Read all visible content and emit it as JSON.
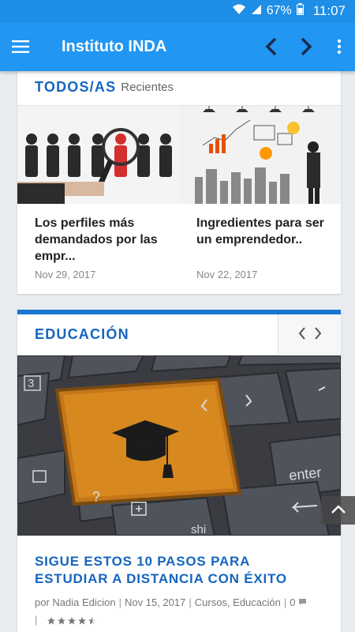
{
  "status_bar": {
    "battery": "67%",
    "time": "11:07"
  },
  "app_bar": {
    "title": "Instituto INDA"
  },
  "recent_section": {
    "title": "TODOS/AS",
    "subtitle": "Recientes",
    "posts": [
      {
        "title": "Los perfiles más demandados por las empr...",
        "date": "Nov 29, 2017"
      },
      {
        "title": "Ingredientes para ser un emprendedor..",
        "date": "Nov 22, 2017"
      }
    ]
  },
  "education_section": {
    "title": "EDUCACIÓN",
    "article": {
      "title": "SIGUE ESTOS 10 PASOS PARA ESTUDIAR A DISTANCIA CON ÉXITO",
      "author": "por Nadia Edicion",
      "date": "Nov 15, 2017",
      "categories": "Cursos, Educación",
      "comments": "0",
      "rating": 4.5
    },
    "image_keys": {
      "three": "3",
      "enter": "enter",
      "question": "?",
      "shift": "shi"
    }
  },
  "colors": {
    "primary": "#2196f3",
    "status": "#1f8ee6",
    "accent": "#1565c0"
  },
  "icons": [
    "wifi-icon",
    "signal-icon",
    "battery-icon",
    "menu-icon",
    "back-arrow-icon",
    "forward-arrow-icon",
    "more-vert-icon",
    "comment-icon",
    "star-icon",
    "chevron-up-icon"
  ]
}
